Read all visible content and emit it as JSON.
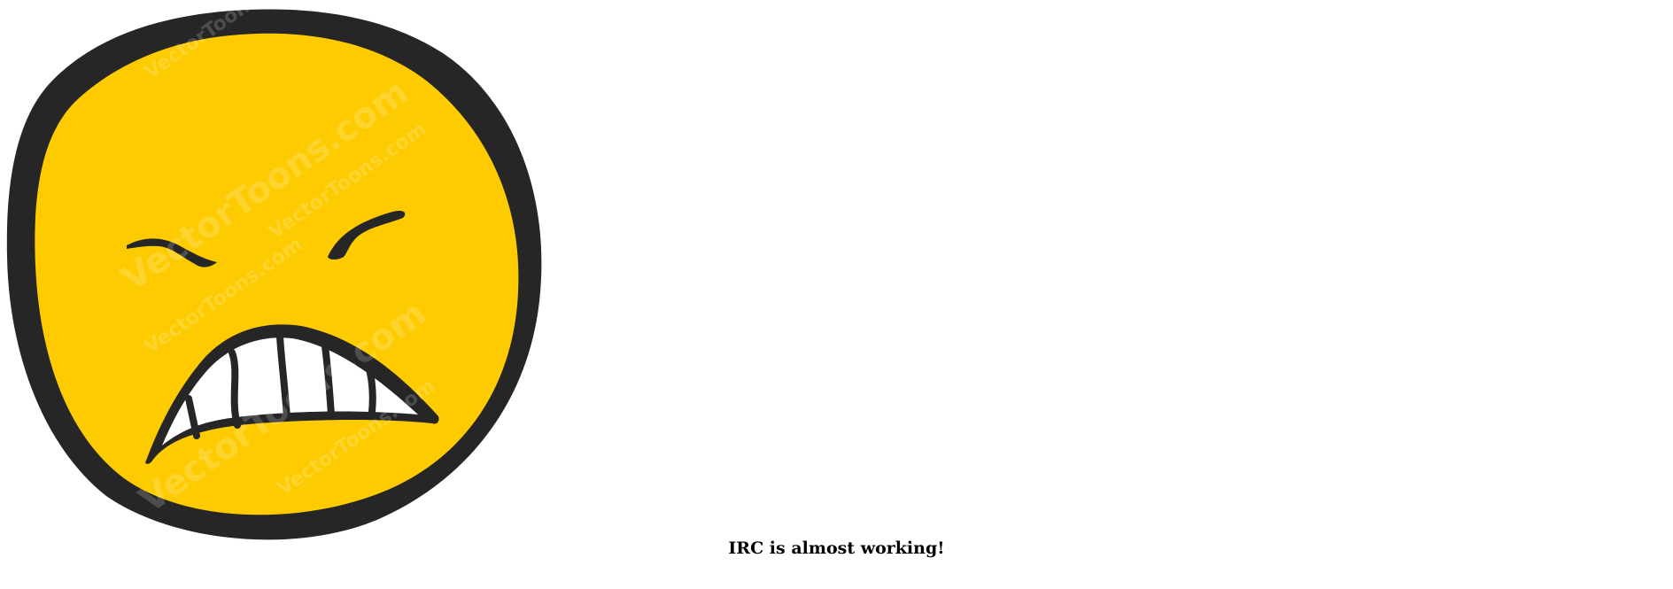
{
  "image": {
    "icon": "grimacing-face-icon",
    "colors": {
      "face_fill": "#fecb00",
      "outline": "#262626",
      "teeth": "#ffffff",
      "background": "#ffffff"
    },
    "watermark_text": "VectorToons.com"
  },
  "caption": {
    "text": "IRC is almost working!"
  }
}
